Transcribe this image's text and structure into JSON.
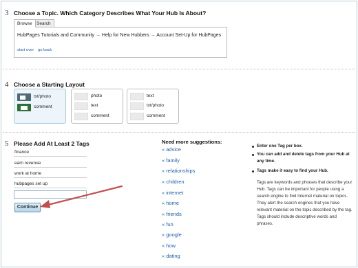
{
  "step3": {
    "number": "3",
    "title": "Choose a Topic. Which Category Describes What Your Hub Is About?",
    "tabs": [
      {
        "label": "Browse"
      },
      {
        "label": "Search"
      }
    ],
    "path": "HubPages Tutorials and Community → Help for New Hubbers → Account Set-Up for HubPages",
    "start_over": "start over",
    "go_back": "go back"
  },
  "step4": {
    "number": "4",
    "title": "Choose a Starting Layout",
    "layouts": [
      {
        "rows": [
          {
            "label": "txt/photo"
          },
          {
            "label": "comment"
          }
        ]
      },
      {
        "rows": [
          {
            "label": "photo"
          },
          {
            "label": "text"
          },
          {
            "label": "comment"
          }
        ]
      },
      {
        "rows": [
          {
            "label": "text"
          },
          {
            "label": "txt/photo"
          },
          {
            "label": "comment"
          }
        ]
      }
    ]
  },
  "step5": {
    "number": "5",
    "title": "Please Add At Least 2 Tags",
    "tags": [
      "finance",
      "earn revenue",
      "work at home",
      "hubpages set up",
      ""
    ],
    "continue_label": "Continue"
  },
  "suggestions": {
    "title": "Need more suggestions:",
    "marker": "«",
    "items": [
      "advice",
      "family",
      "relationships",
      "children",
      "internet",
      "home",
      "friends",
      "fun",
      "google",
      "how",
      "dating"
    ]
  },
  "tips": {
    "items": [
      "Enter one Tag per box.",
      "You can add and delete tags from your Hub at any time.",
      "Tags make it easy to find your Hub."
    ],
    "body": "Tags are keywords and phrases that describe your Hub. Tags can be important for people using a search engine to find Internet material on topics. They alert the search engines that you have relevant material on the topic described by the tag. Tags should include descriptive words and phrases."
  },
  "colors": {
    "link": "#1d5fa8",
    "annotation_arrow": "#c0504d",
    "selected_layout_bg": "#eef5fa"
  }
}
